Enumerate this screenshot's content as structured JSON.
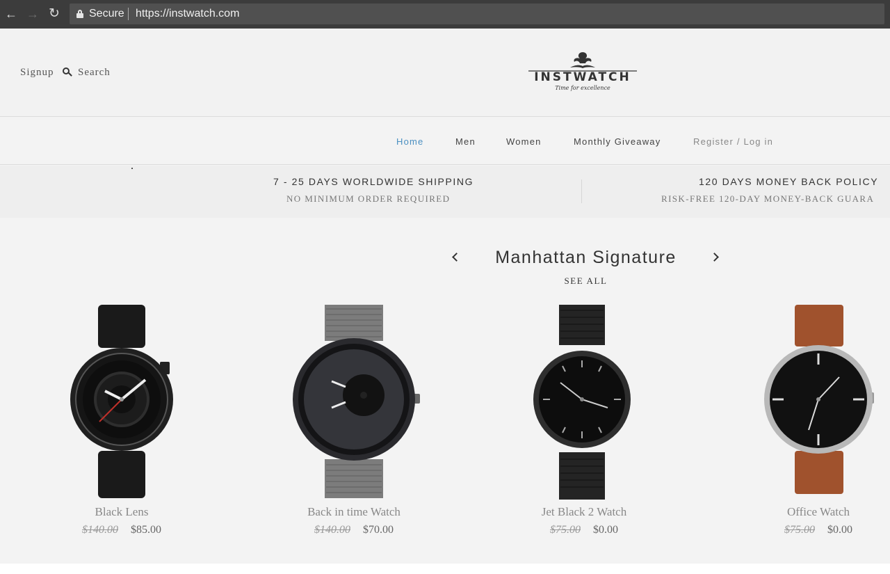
{
  "browser": {
    "secure_label": "Secure",
    "url": "https://instwatch.com"
  },
  "header": {
    "signup_label": "Signup",
    "search_label": "Search",
    "logo_text": "INSTWATCH",
    "logo_tagline": "Time for excellence"
  },
  "nav": {
    "items": [
      {
        "label": "Home"
      },
      {
        "label": "Men"
      },
      {
        "label": "Women"
      },
      {
        "label": "Monthly Giveaway"
      },
      {
        "label": "Register / Log in"
      }
    ]
  },
  "benefits": [
    {
      "title": "7 - 25 DAYS WORLDWIDE SHIPPING",
      "subtitle": "NO MINIMUM ORDER REQUIRED"
    },
    {
      "title": "120 DAYS MONEY BACK POLICY",
      "subtitle": "RISK-FREE 120-DAY MONEY-BACK GUARA"
    }
  ],
  "collection": {
    "title": "Manhattan Signature",
    "see_all": "SEE ALL"
  },
  "products": [
    {
      "name": "Black Lens",
      "old_price": "$140.00",
      "price": "$85.00"
    },
    {
      "name": "Back in time Watch",
      "old_price": "$140.00",
      "price": "$70.00"
    },
    {
      "name": "Jet Black 2 Watch",
      "old_price": "$75.00",
      "price": "$0.00"
    },
    {
      "name": "Office Watch",
      "old_price": "$75.00",
      "price": "$0.00"
    }
  ],
  "colors": {
    "active_nav": "#4a8fc1",
    "background": "#f3f3f3",
    "strap_brown": "#a0522d"
  }
}
